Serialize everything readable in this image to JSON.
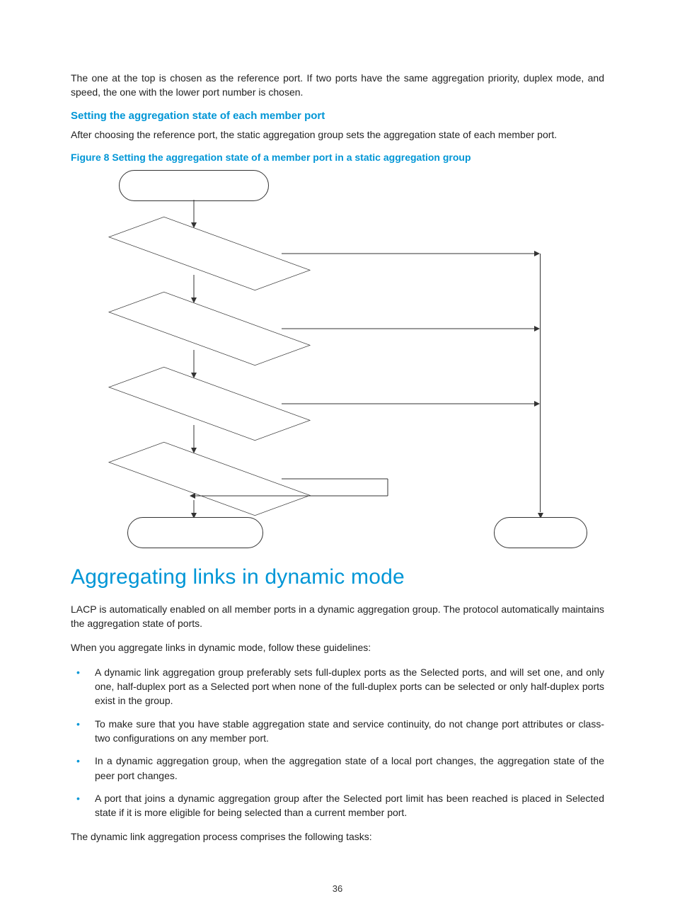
{
  "intro_paragraph": "The one at the top is chosen as the reference port. If two ports have the same aggregation priority, duplex mode, and speed, the one with the lower port number is chosen.",
  "subheading": "Setting the aggregation state of each member port",
  "sub_para": "After choosing the reference port, the static aggregation group sets the aggregation state of each member port.",
  "figure_caption": "Figure 8 Setting the aggregation state of a member port in a static aggregation group",
  "section_heading": "Aggregating links in dynamic mode",
  "dyn_para1": "LACP is automatically enabled on all member ports in a dynamic aggregation group. The protocol automatically maintains the aggregation state of ports.",
  "dyn_para2": "When you aggregate links in dynamic mode, follow these guidelines:",
  "bullets": [
    "A dynamic link aggregation group preferably sets full-duplex ports as the Selected ports, and will set one, and only one, half-duplex port as a Selected port when none of the full-duplex ports can be selected or only half-duplex ports exist in the group.",
    "To make sure that you have stable aggregation state and service continuity, do not change port attributes or class-two configurations on any member port.",
    "In a dynamic aggregation group, when the aggregation state of a local port changes, the aggregation state of the peer port changes.",
    "A port that joins a dynamic aggregation group after the Selected port limit has been reached is placed in Selected state if it is more eligible for being selected than a current member port."
  ],
  "dyn_para3": "The dynamic link aggregation process comprises the following tasks:",
  "page_number": "36"
}
